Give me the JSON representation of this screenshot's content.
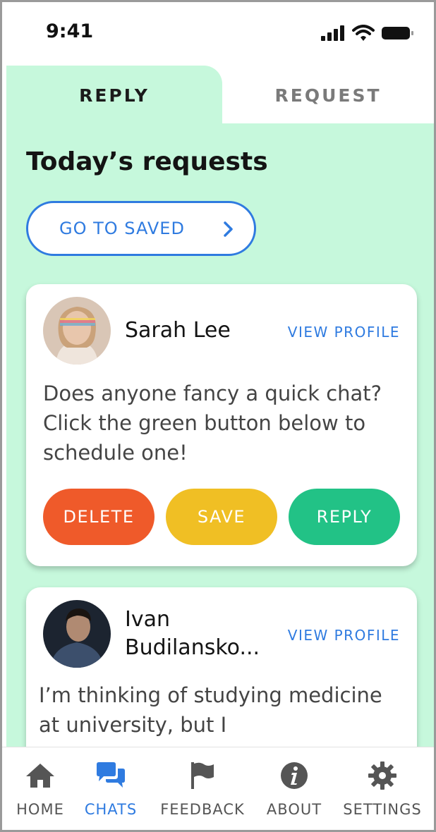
{
  "status_bar": {
    "time": "9:41",
    "icons": [
      "cellular-signal-icon",
      "wifi-icon",
      "battery-icon"
    ]
  },
  "tabs": [
    {
      "label": "REPLY",
      "active": true
    },
    {
      "label": "REQUEST",
      "active": false
    }
  ],
  "main": {
    "title": "Today’s requests",
    "saved_button": {
      "label": "GO TO SAVED",
      "icon": "chevron-right-icon"
    }
  },
  "requests": [
    {
      "name": "Sarah Lee",
      "view_profile": "VIEW PROFILE",
      "message": "Does anyone fancy a quick chat? Click the green button below to schedule one!",
      "actions": {
        "delete": "DELETE",
        "save": "SAVE",
        "reply": "REPLY"
      }
    },
    {
      "name_line1": "Ivan",
      "name_line2": "Budilansko...",
      "view_profile": "VIEW PROFILE",
      "message": "I’m thinking of studying medicine at university, but I"
    }
  ],
  "bottom_nav": {
    "items": [
      {
        "label": "HOME",
        "icon": "home-icon",
        "active": false
      },
      {
        "label": "CHATS",
        "icon": "chats-icon",
        "active": true
      },
      {
        "label": "FEEDBACK",
        "icon": "flag-icon",
        "active": false
      },
      {
        "label": "ABOUT",
        "icon": "info-icon",
        "active": false
      },
      {
        "label": "SETTINGS",
        "icon": "gear-icon",
        "active": false
      }
    ]
  },
  "colors": {
    "accent": "#2f7be0",
    "background_green": "#c6f8dc",
    "delete": "#ef5a2a",
    "save": "#f0bf24",
    "reply": "#22c286"
  }
}
